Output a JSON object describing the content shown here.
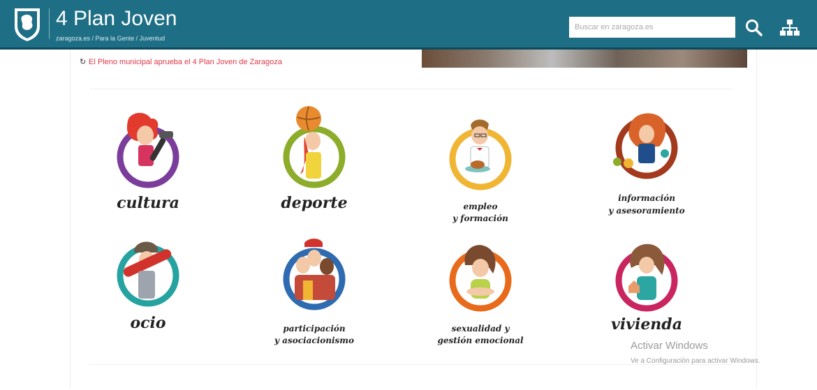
{
  "header": {
    "title": "4 Plan Joven",
    "breadcrumb": [
      "zaragoza.es",
      "Para la Gente",
      "Juventud"
    ],
    "breadcrumb_sep": " / ",
    "search_placeholder": "Buscar en zaragoza.es"
  },
  "news": {
    "text": "El Pleno municipal aprueba el 4 Plan Joven de Zaragoza"
  },
  "categories": [
    {
      "label": "cultura",
      "ring_color": "#7a3d9b",
      "icon": "musician-girl-icon"
    },
    {
      "label": "deporte",
      "ring_color": "#8cac2a",
      "icon": "basketball-girl-icon"
    },
    {
      "label_line1": "empleo",
      "label_line2": "y formación",
      "ring_color": "#f0b533",
      "icon": "waiter-boy-icon"
    },
    {
      "label_line1": "información",
      "label_line2": "y asesoramiento",
      "ring_color": "#a33a1e",
      "icon": "info-girl-icon"
    },
    {
      "label": "ocio",
      "ring_color": "#26a3a0",
      "icon": "skater-girl-icon"
    },
    {
      "label_line1": "participación",
      "label_line2": "y asociacionismo",
      "ring_color": "#2e6bb0",
      "icon": "group-youth-icon"
    },
    {
      "label_line1": "sexualidad y",
      "label_line2": "gestión emocional",
      "ring_color": "#e86a1b",
      "icon": "hugging-girl-icon"
    },
    {
      "label": "vivienda",
      "ring_color": "#c9255f",
      "icon": "home-girl-icon"
    }
  ],
  "watermark": {
    "line1": "Activar Windows",
    "line2": "Ve a Configuración para activar Windows."
  }
}
